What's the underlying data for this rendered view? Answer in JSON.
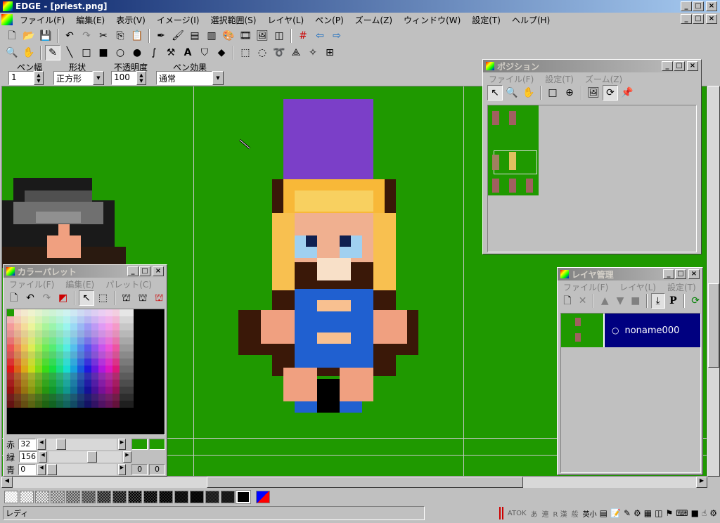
{
  "window": {
    "title": "EDGE - [priest.png]"
  },
  "menubar": [
    "ファイル(F)",
    "編集(E)",
    "表示(V)",
    "イメージ(I)",
    "選択範囲(S)",
    "レイヤ(L)",
    "ペン(P)",
    "ズーム(Z)",
    "ウィンドウ(W)",
    "設定(T)",
    "ヘルプ(H)"
  ],
  "pen_bar": {
    "width_label": "ペン幅",
    "width_value": "1",
    "shape_label": "形状",
    "shape_value": "正方形",
    "opacity_label": "不透明度",
    "opacity_value": "100",
    "effect_label": "ペン効果",
    "effect_value": "通常"
  },
  "position_panel": {
    "title": "ポジション",
    "menu": [
      "ファイル(F)",
      "設定(T)",
      "ズーム(Z)"
    ]
  },
  "palette_panel": {
    "title": "カラーパレット",
    "menu": [
      "ファイル(F)",
      "編集(E)",
      "パレット(C)"
    ],
    "sliders": [
      {
        "label": "赤",
        "value": "32",
        "level": 32
      },
      {
        "label": "緑",
        "value": "156",
        "level": 156
      },
      {
        "label": "青",
        "value": "0",
        "level": 0
      }
    ],
    "slot_a": "0",
    "slot_b": "0"
  },
  "layer_panel": {
    "title": "レイヤ管理",
    "menu": [
      "ファイル(F)",
      "レイヤ(L)",
      "設定(T)"
    ],
    "layer_name": "noname000"
  },
  "status": {
    "text": "レディ",
    "ime": [
      "ATOK",
      "あ",
      "連",
      "R 漢",
      "般",
      "英小"
    ]
  },
  "colors": {
    "canvas_bg": "#1f9900",
    "accent": "#0a246a",
    "layer_sel": "#000080"
  }
}
